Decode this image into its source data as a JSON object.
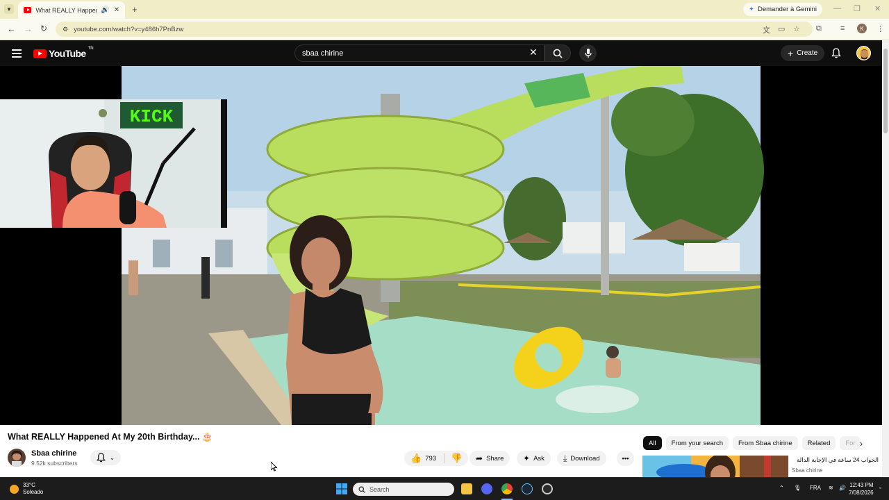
{
  "browser": {
    "tab_title": "What REALLY Happened At",
    "gemini_label": "Demander à Gemini",
    "url": "youtube.com/watch?v=y486h7PnBzw",
    "profile_initial": "K"
  },
  "youtube": {
    "logo_text": "YouTube",
    "logo_suffix": "TN",
    "search_value": "sbaa chirine",
    "create_label": "Create"
  },
  "video": {
    "title": "What REALLY Happened At My 20th Birthday...",
    "title_emoji": "🎂",
    "overlay_sign": "KICK",
    "channel_name": "Sbaa chirine",
    "subscribers": "9.52k subscribers",
    "likes": "793",
    "share_label": "Share",
    "ask_label": "Ask",
    "download_label": "Download"
  },
  "chips": [
    {
      "label": "All",
      "active": true
    },
    {
      "label": "From your search",
      "active": false
    },
    {
      "label": "From Sbaa chirine",
      "active": false
    },
    {
      "label": "Related",
      "active": false
    },
    {
      "label": "For",
      "active": false
    }
  ],
  "recommendation": {
    "title": "الجواب 24 ساعة في الإجابة الدالة",
    "channel": "Sbaa chirine"
  },
  "taskbar": {
    "temperature": "33°C",
    "weather": "Soleado",
    "search_placeholder": "Search",
    "language": "FRA",
    "time": "12:43 PM",
    "date": "7/08/2026"
  },
  "colors": {
    "tabstrip": "#f1eec7",
    "youtube_header": "#0f0f0f",
    "youtube_red": "#ff0000",
    "slide_green": "#b9dd5c",
    "pool_water": "#a6ddc6",
    "float_yellow": "#f4d21c"
  }
}
